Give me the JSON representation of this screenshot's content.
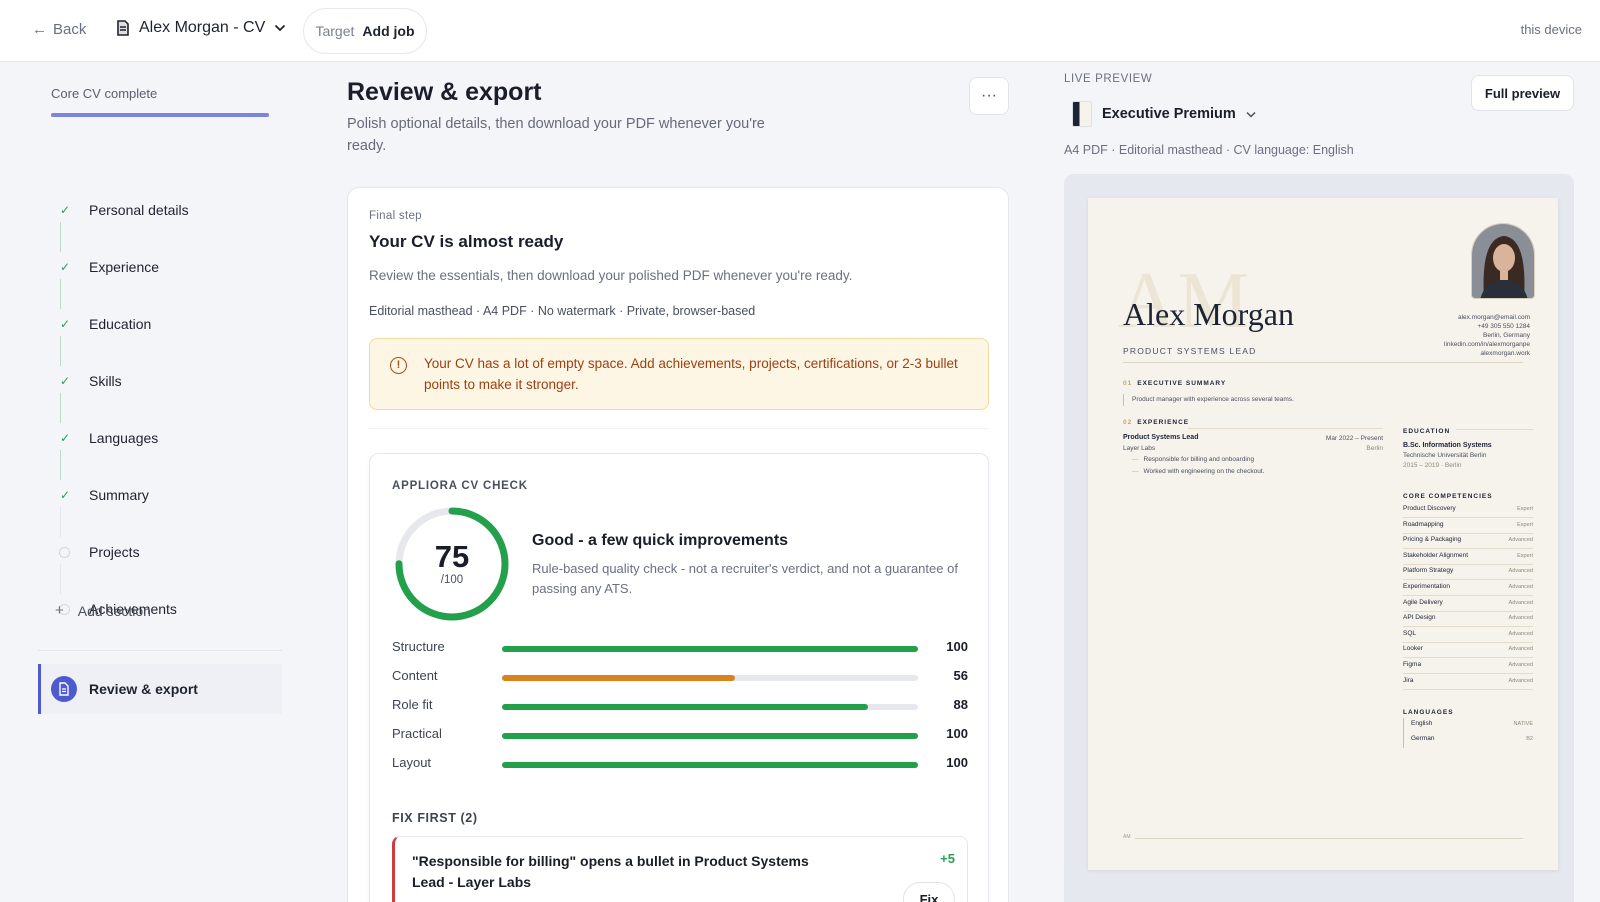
{
  "topbar": {
    "back_label": "Back",
    "doc_title": "Alex Morgan - CV",
    "target_label": "Target",
    "target_value": "Add job",
    "device_label": "this device"
  },
  "sidebar": {
    "progress_label": "Core CV complete",
    "progress_fraction": 1.0,
    "steps": [
      {
        "label": "Personal details",
        "done": true
      },
      {
        "label": "Experience",
        "done": true
      },
      {
        "label": "Education",
        "done": true
      },
      {
        "label": "Skills",
        "done": true
      },
      {
        "label": "Languages",
        "done": true
      },
      {
        "label": "Summary",
        "done": true
      },
      {
        "label": "Projects",
        "done": false
      },
      {
        "label": "Achievements",
        "done": false
      }
    ],
    "add_section_label": "Add section",
    "active_label": "Review & export"
  },
  "main": {
    "title": "Review & export",
    "subtitle": "Polish optional details, then download your PDF whenever you're ready.",
    "more_label": "···",
    "card": {
      "eyebrow": "Final step",
      "title": "Your CV is almost ready",
      "subtitle": "Review the essentials, then download your polished PDF whenever you're ready.",
      "meta": "Editorial masthead · A4 PDF · No watermark · Private, browser-based",
      "warning": "Your CV has a lot of empty space. Add achievements, projects, certifications, or 2-3 bullet points to make it stronger."
    },
    "check": {
      "eyebrow": "APPLIORA CV CHECK",
      "score": "75",
      "score_max": "/100",
      "score_fraction": 0.75,
      "verdict": "Good - a few quick improvements",
      "note": "Rule-based quality check - not a recruiter's verdict, and not a guarantee of passing any ATS.",
      "metrics": [
        {
          "name": "Structure",
          "value": "100",
          "fraction": 1.0,
          "color": "#22a04b"
        },
        {
          "name": "Content",
          "value": "56",
          "fraction": 0.56,
          "color": "#d9821e"
        },
        {
          "name": "Role fit",
          "value": "88",
          "fraction": 0.88,
          "color": "#22a04b"
        },
        {
          "name": "Practical",
          "value": "100",
          "fraction": 1.0,
          "color": "#22a04b"
        },
        {
          "name": "Layout",
          "value": "100",
          "fraction": 1.0,
          "color": "#22a04b"
        }
      ],
      "fix_heading": "FIX FIRST (2)",
      "fix_item": {
        "text": "\"Responsible for billing\" opens a bullet in Product Systems Lead - Layer Labs",
        "points": "+5",
        "button": "Fix"
      }
    }
  },
  "preview": {
    "live_label": "LIVE PREVIEW",
    "template_name": "Executive Premium",
    "full_button": "Full preview",
    "meta": "A4 PDF · Editorial masthead · CV language: English",
    "cv": {
      "monogram": "AM",
      "name": "Alex Morgan",
      "role": "PRODUCT SYSTEMS LEAD",
      "contacts": [
        "alex.morgan@email.com",
        "+49 305 550 1284",
        "Berlin, Germany",
        "linkedin.com/in/alexmorganpe",
        "alexmorgan.work"
      ],
      "summary_num": "01",
      "summary_title": "EXECUTIVE SUMMARY",
      "summary_text": "Product manager with experience across several teams.",
      "exp_num": "02",
      "exp_title": "EXPERIENCE",
      "job_title": "Product Systems Lead",
      "job_dates": "Mar 2022 – Present",
      "job_company": "Layer Labs",
      "job_location": "Berlin",
      "bullets": [
        "Responsible for billing and onboarding",
        "Worked with engineering on the checkout."
      ],
      "edu_title": "EDUCATION",
      "edu_degree": "B.Sc. Information Systems",
      "edu_school": "Technische Universität Berlin",
      "edu_dates": "2015 – 2019 · Berlin",
      "comp_title": "CORE COMPETENCIES",
      "competencies": [
        {
          "name": "Product Discovery",
          "level": "Expert"
        },
        {
          "name": "Roadmapping",
          "level": "Expert"
        },
        {
          "name": "Pricing & Packaging",
          "level": "Advanced"
        },
        {
          "name": "Stakeholder Alignment",
          "level": "Expert"
        },
        {
          "name": "Platform Strategy",
          "level": "Advanced"
        },
        {
          "name": "Experimentation",
          "level": "Advanced"
        },
        {
          "name": "Agile Delivery",
          "level": "Advanced"
        },
        {
          "name": "API Design",
          "level": "Advanced"
        },
        {
          "name": "SQL",
          "level": "Advanced"
        },
        {
          "name": "Looker",
          "level": "Advanced"
        },
        {
          "name": "Figma",
          "level": "Advanced"
        },
        {
          "name": "Jira",
          "level": "Advanced"
        }
      ],
      "lang_title": "LANGUAGES",
      "languages": [
        {
          "name": "English",
          "level": "NATIVE"
        },
        {
          "name": "German",
          "level": "B2"
        }
      ],
      "footer": "AM"
    }
  },
  "colors": {
    "accent": "#4e5bd0",
    "success": "#22a04b",
    "warning_text": "#9c3f12",
    "warning_bg": "#fdf6e4",
    "danger": "#d23b3b"
  }
}
